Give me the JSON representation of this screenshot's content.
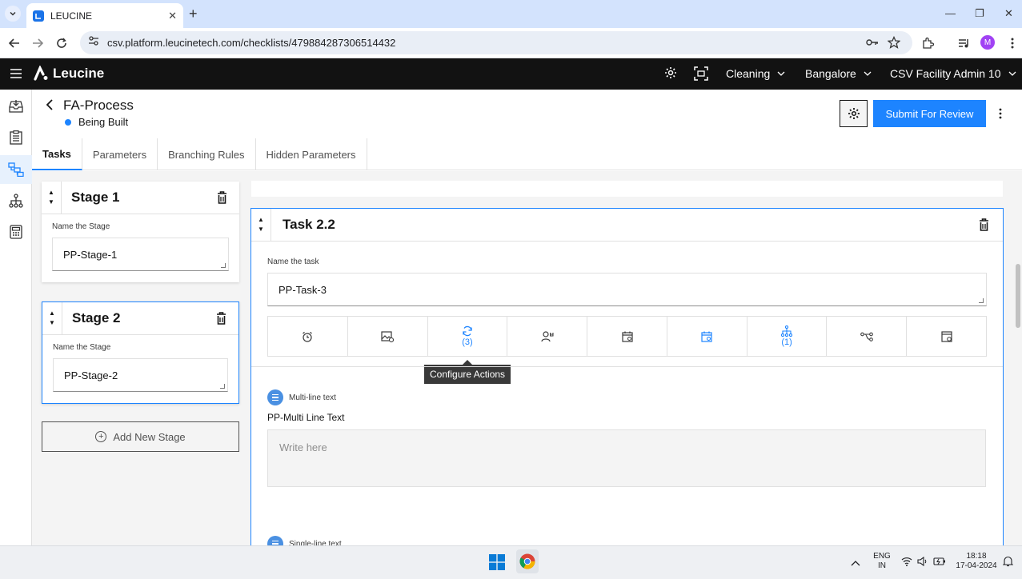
{
  "browser": {
    "tab_title": "LEUCINE",
    "url": "csv.platform.leucinetech.com/checklists/479884287306514432",
    "profile_initial": "M"
  },
  "app": {
    "brand": "Leucine",
    "use_case": "Cleaning",
    "facility": "Bangalore",
    "user": "CSV Facility Admin 10"
  },
  "process": {
    "title": "FA-Process",
    "status": "Being Built",
    "submit_label": "Submit For Review"
  },
  "tabs": [
    {
      "label": "Tasks",
      "active": true
    },
    {
      "label": "Parameters",
      "active": false
    },
    {
      "label": "Branching Rules",
      "active": false
    },
    {
      "label": "Hidden Parameters",
      "active": false
    }
  ],
  "stages": [
    {
      "title": "Stage 1",
      "field_label": "Name the Stage",
      "value": "PP-Stage-1"
    },
    {
      "title": "Stage 2",
      "field_label": "Name the Stage",
      "value": "PP-Stage-2"
    }
  ],
  "add_stage_label": "Add New Stage",
  "task": {
    "title": "Task 2.2",
    "field_label": "Name the task",
    "value": "PP-Task-3",
    "toolbar": [
      {
        "icon": "alarm-clock-icon",
        "count": ""
      },
      {
        "icon": "image-add-icon",
        "count": ""
      },
      {
        "icon": "refresh-actions-icon",
        "count": "(3)"
      },
      {
        "icon": "user-assign-icon",
        "count": ""
      },
      {
        "icon": "calendar-schedule-icon",
        "count": ""
      },
      {
        "icon": "calendar-timer-icon",
        "count": ""
      },
      {
        "icon": "hierarchy-icon",
        "count": "(1)"
      },
      {
        "icon": "branch-icon",
        "count": ""
      },
      {
        "icon": "save-form-icon",
        "count": ""
      }
    ],
    "tooltip": "Configure Actions"
  },
  "parameters": [
    {
      "type": "Multi-line text",
      "name": "PP-Multi Line Text",
      "placeholder": "Write here"
    },
    {
      "type": "Single-line text"
    }
  ],
  "taskbar": {
    "lang_top": "ENG",
    "lang_bottom": "IN",
    "time": "18:18",
    "date": "17-04-2024"
  },
  "colors": {
    "accent": "#1d84ff",
    "header_bg": "#121212"
  }
}
